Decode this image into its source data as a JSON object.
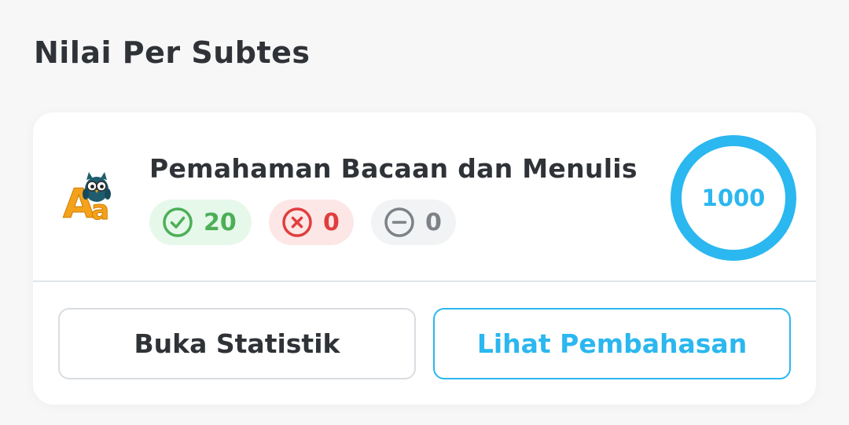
{
  "section": {
    "title": "Nilai Per Subtes"
  },
  "subtest": {
    "icon": "reading-owl-icon",
    "icon_letters": "Aa",
    "title": "Pemahaman Bacaan dan Menulis",
    "score": "1000",
    "score_fraction": 1.0,
    "stats": {
      "correct": "20",
      "wrong": "0",
      "empty": "0"
    }
  },
  "actions": {
    "statistics_label": "Buka Statistik",
    "review_label": "Lihat Pembahasan"
  },
  "colors": {
    "accent": "#2bb7ef",
    "correct": "#4caf58",
    "wrong": "#e03e3e",
    "empty": "#7d8287"
  }
}
